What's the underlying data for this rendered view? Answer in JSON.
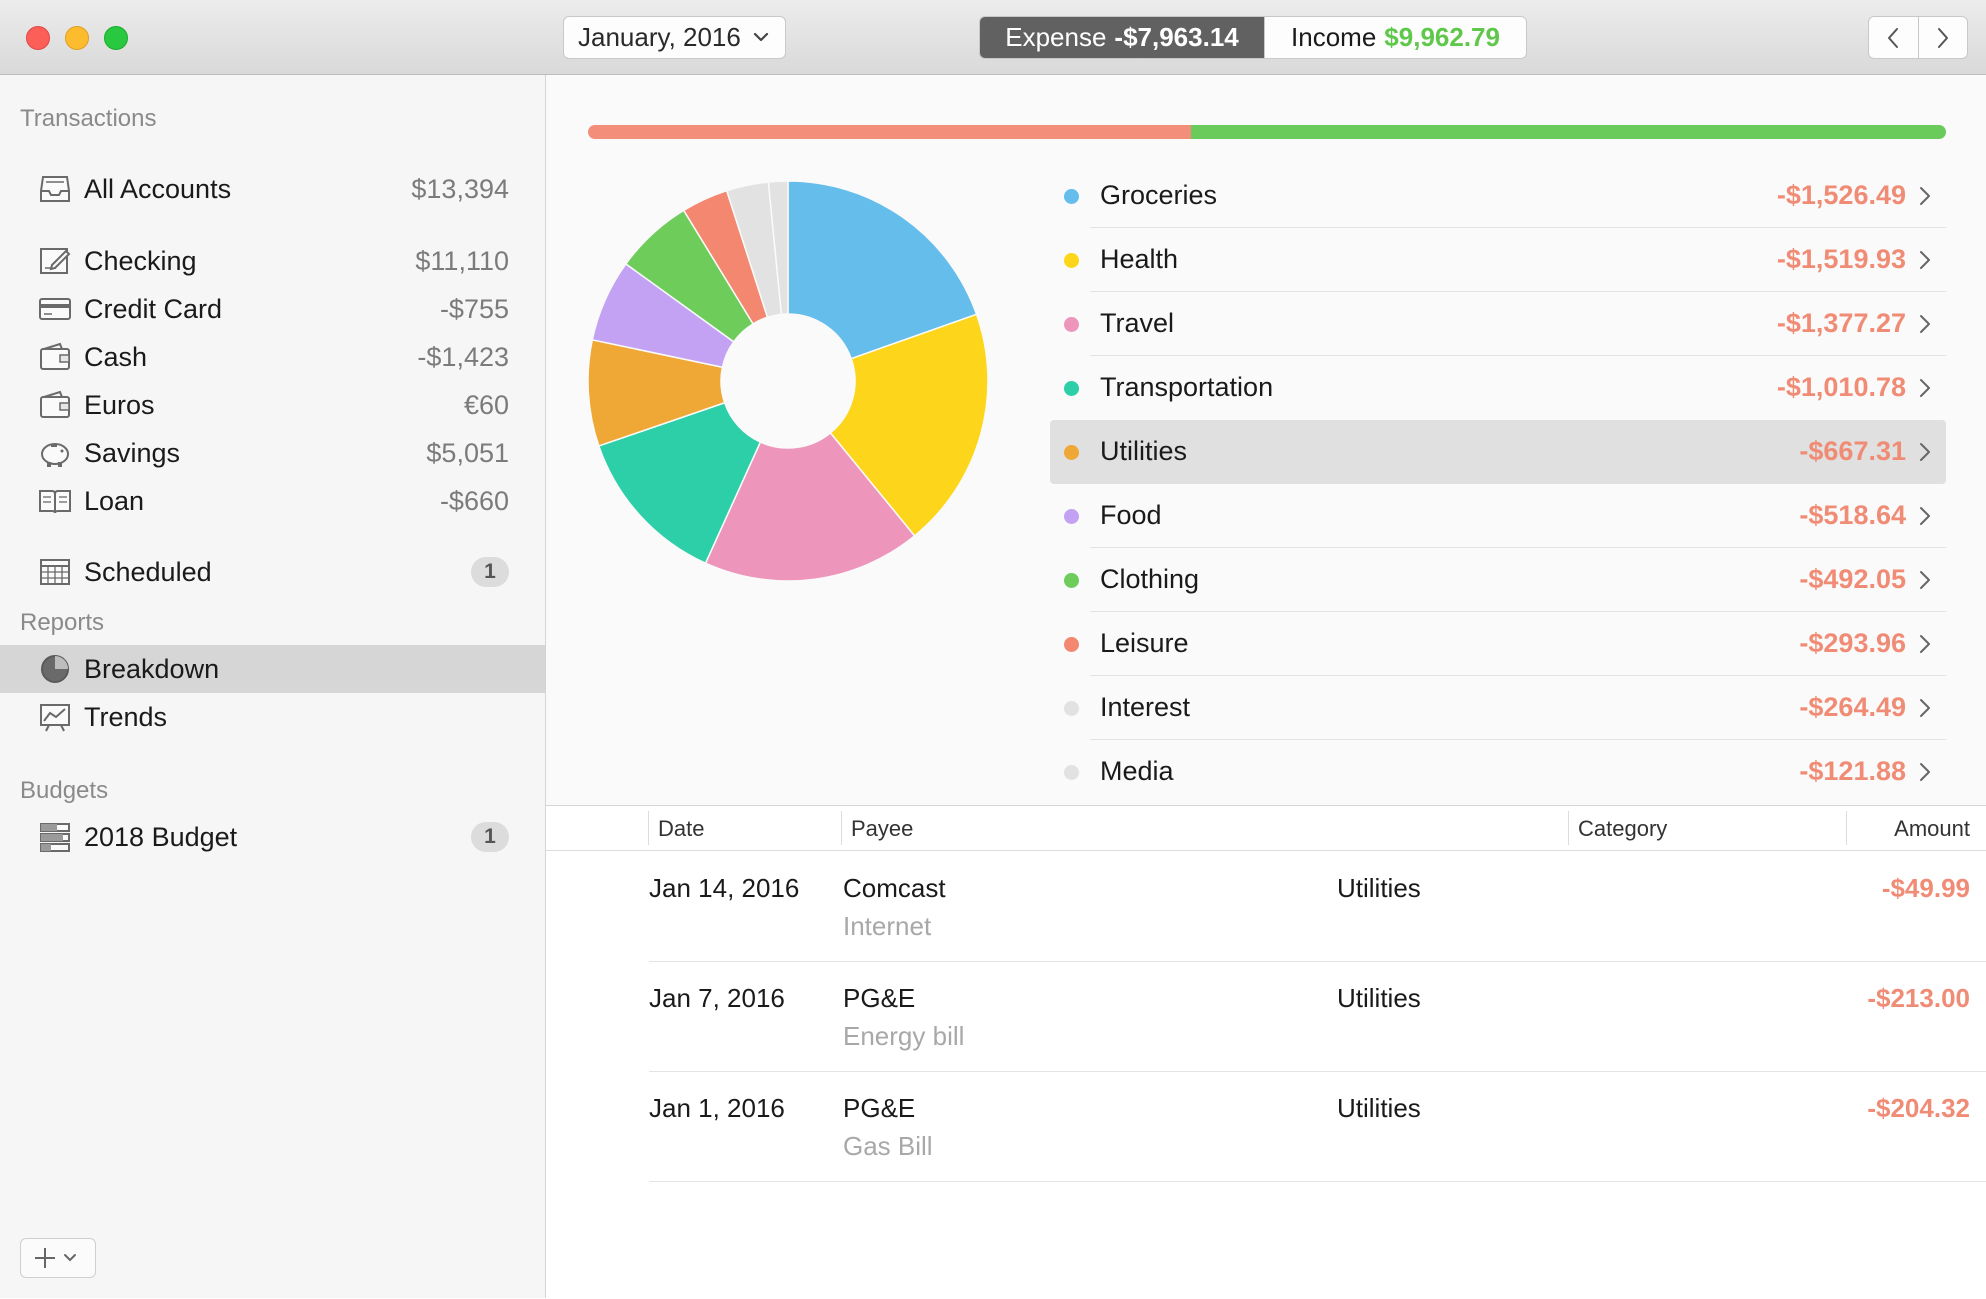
{
  "toolbar": {
    "month": "January, 2016",
    "expense_label": "Expense",
    "expense_value": "-$7,963.14",
    "income_label": "Income",
    "income_value": "$9,962.79"
  },
  "sidebar": {
    "transactions_title": "Transactions",
    "all_accounts": {
      "label": "All Accounts",
      "value": "$13,394",
      "icon": "inbox-icon"
    },
    "accounts": [
      {
        "label": "Checking",
        "value": "$11,110",
        "icon": "checkbook-icon"
      },
      {
        "label": "Credit Card",
        "value": "-$755",
        "icon": "credit-card-icon"
      },
      {
        "label": "Cash",
        "value": "-$1,423",
        "icon": "wallet-icon"
      },
      {
        "label": "Euros",
        "value": "€60",
        "icon": "wallet-icon"
      },
      {
        "label": "Savings",
        "value": "$5,051",
        "icon": "piggy-bank-icon"
      },
      {
        "label": "Loan",
        "value": "-$660",
        "icon": "book-icon"
      }
    ],
    "scheduled": {
      "label": "Scheduled",
      "badge": "1",
      "icon": "calendar-icon"
    },
    "reports_title": "Reports",
    "reports": [
      {
        "label": "Breakdown",
        "icon": "pie-chart-icon",
        "selected": true
      },
      {
        "label": "Trends",
        "icon": "trend-chart-icon",
        "selected": false
      }
    ],
    "budgets_title": "Budgets",
    "budgets": [
      {
        "label": "2018 Budget",
        "badge": "1",
        "icon": "budget-icon"
      }
    ]
  },
  "ratio": {
    "expense_fraction": 0.444,
    "expense_color": "#f28e79",
    "income_color": "#6acb5a"
  },
  "chart_data": {
    "type": "pie",
    "categories": [
      "Groceries",
      "Health",
      "Travel",
      "Transportation",
      "Utilities",
      "Food",
      "Clothing",
      "Leisure",
      "Interest",
      "Media"
    ],
    "values": [
      1526.49,
      1519.93,
      1377.27,
      1010.78,
      667.31,
      518.64,
      492.05,
      293.96,
      264.49,
      121.88
    ],
    "labels": [
      "-$1,526.49",
      "-$1,519.93",
      "-$1,377.27",
      "-$1,010.78",
      "-$667.31",
      "-$518.64",
      "-$492.05",
      "-$293.96",
      "-$264.49",
      "-$121.88"
    ],
    "colors": [
      "#64bdea",
      "#fdd61c",
      "#ee95bb",
      "#2dcfa9",
      "#efa836",
      "#c3a2f4",
      "#6ecd5a",
      "#f3876f",
      "#e2e2e2",
      "#e2e2e2"
    ],
    "selected": "Utilities",
    "donut": true
  },
  "table": {
    "headers": {
      "date": "Date",
      "payee": "Payee",
      "category": "Category",
      "amount": "Amount"
    },
    "rows": [
      {
        "date": "Jan 14, 2016",
        "payee": "Comcast",
        "memo": "Internet",
        "category": "Utilities",
        "amount": "-$49.99"
      },
      {
        "date": "Jan 7, 2016",
        "payee": "PG&E",
        "memo": "Energy bill",
        "category": "Utilities",
        "amount": "-$213.00"
      },
      {
        "date": "Jan 1, 2016",
        "payee": "PG&E",
        "memo": "Gas Bill",
        "category": "Utilities",
        "amount": "-$204.32"
      }
    ]
  }
}
